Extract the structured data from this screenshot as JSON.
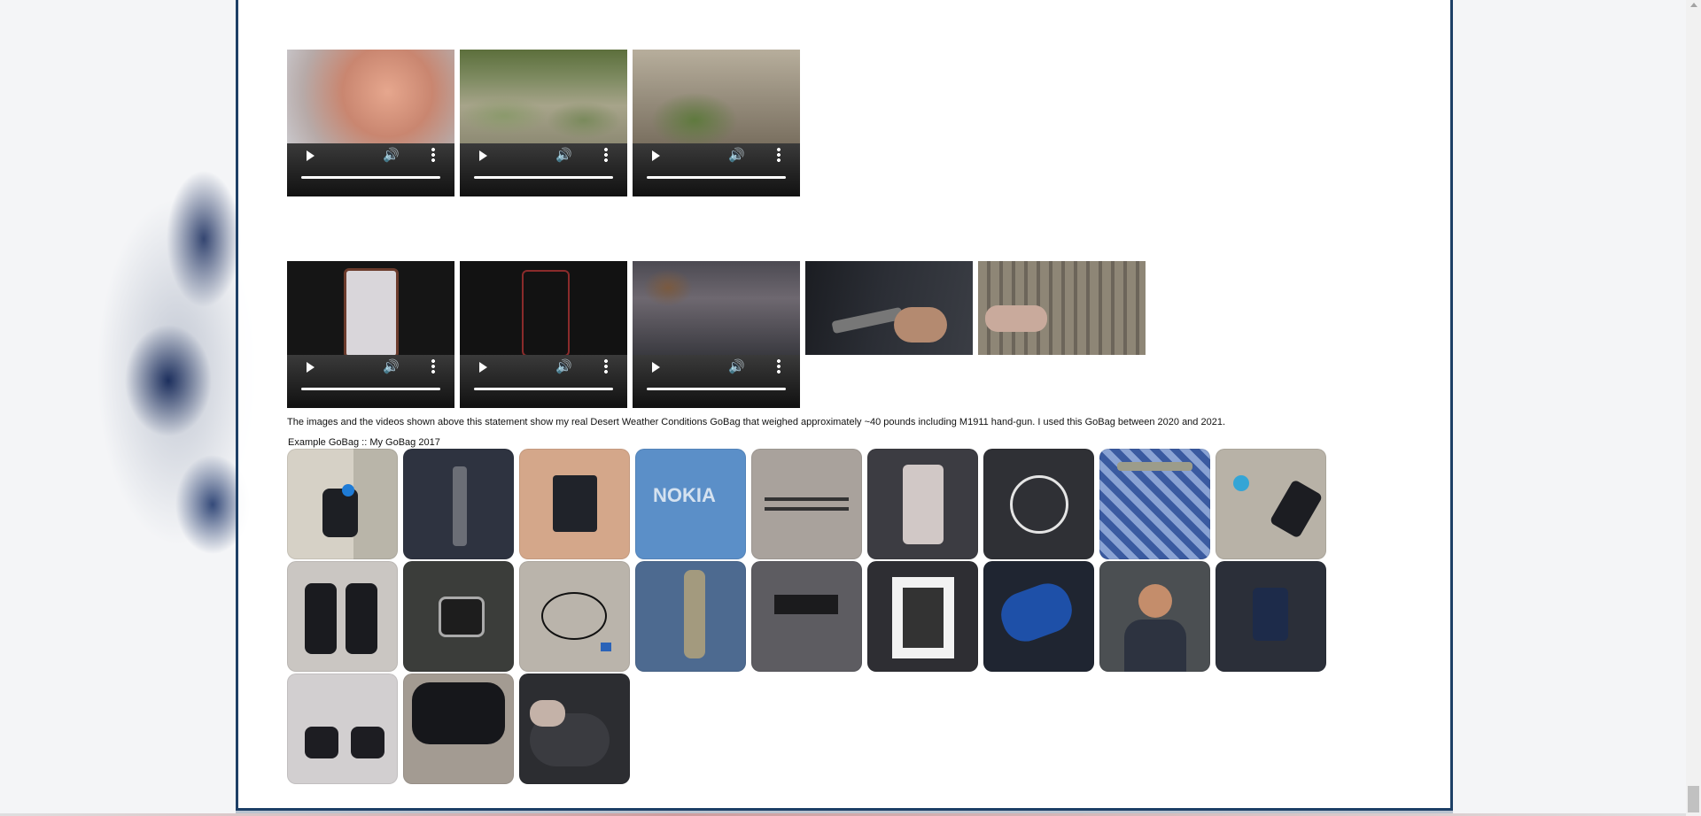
{
  "statement": "The images and the videos shown above this statement show my real Desert Weather Conditions GoBag that weighed approximately ~40 pounds including M1911 hand-gun. I used this GoBag between 2020 and 2021.",
  "gallery_caption": "Example GoBag :: My GoBag 2017",
  "video_rows": [
    {
      "videos": [
        {
          "id": "v1",
          "muted": false
        },
        {
          "id": "v2",
          "muted": false
        },
        {
          "id": "v3",
          "muted": false
        }
      ]
    },
    {
      "videos": [
        {
          "id": "v4",
          "muted": true
        },
        {
          "id": "v5",
          "muted": true
        },
        {
          "id": "v6",
          "muted": false
        }
      ]
    }
  ],
  "icons": {
    "play": "play-icon",
    "volume": "volume-icon",
    "more": "more-options-icon"
  },
  "colors": {
    "frame_border": "#1d3f66",
    "controls_bg": "#1a1a1a"
  },
  "gallery_tiles": [
    "Backpack on floor",
    "Flashlight",
    "Wallet in hand",
    "Nokia phone box",
    "Pens",
    "Phone rear",
    "Earphones",
    "Knife on blanket",
    "Accessories",
    "Boots pair",
    "Wrist watch",
    "Cable",
    "Knife with sheath",
    "Scarf",
    "Phone box",
    "Insoles",
    "Person",
    "Pouch",
    "Boots",
    "Black shoes",
    "Bag"
  ]
}
